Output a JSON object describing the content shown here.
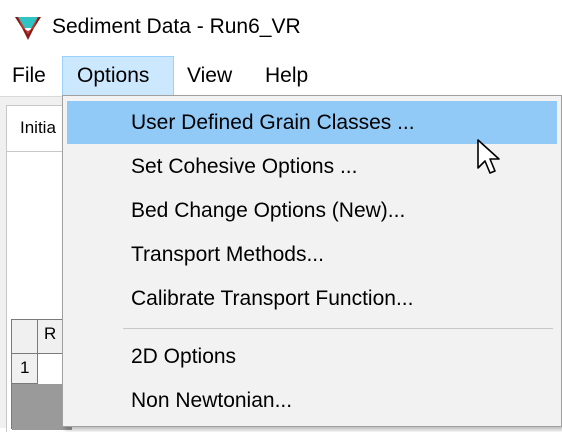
{
  "window": {
    "title": "Sediment Data - Run6_VR",
    "icon": "hec-ras-app-icon"
  },
  "menubar": {
    "items": [
      {
        "label": "File"
      },
      {
        "label": "Options",
        "active": true
      },
      {
        "label": "View"
      },
      {
        "label": "Help"
      }
    ]
  },
  "background": {
    "tab_label": "Initia",
    "grid": {
      "column_header": "R",
      "row_header": "1"
    }
  },
  "options_menu": {
    "items": [
      {
        "label": "User Defined Grain Classes ...",
        "highlighted": true
      },
      {
        "label": "Set Cohesive Options ..."
      },
      {
        "label": "Bed Change Options (New)..."
      },
      {
        "label": "Transport Methods..."
      },
      {
        "label": "Calibrate Transport Function..."
      },
      {
        "separator": true
      },
      {
        "label": "2D Options"
      },
      {
        "label": "Non Newtonian..."
      }
    ]
  },
  "colors": {
    "menu_active_bg": "#cce8ff",
    "menu_active_border": "#99d1ff",
    "item_highlight": "#91c9f7",
    "dropdown_bg": "#f2f2f2"
  },
  "cursor": "arrow-pointer-icon"
}
